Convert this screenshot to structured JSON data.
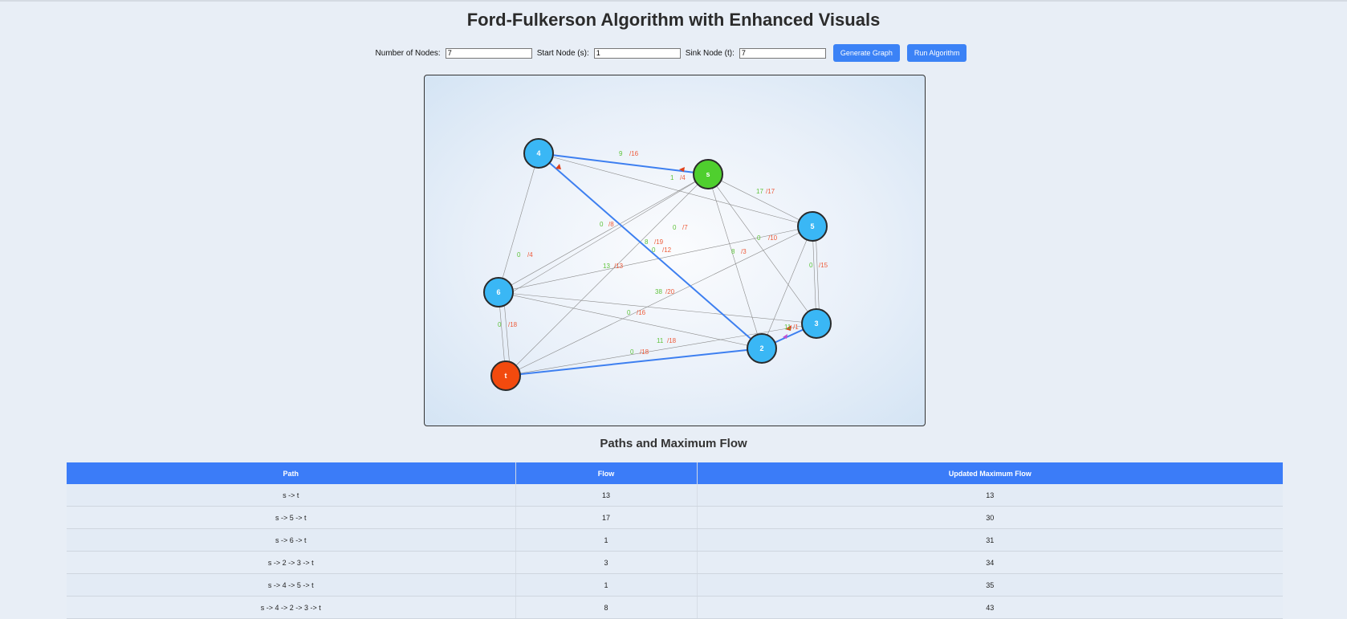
{
  "title": "Ford-Fulkerson Algorithm with Enhanced Visuals",
  "controls": {
    "num_nodes_label": "Number of Nodes:",
    "num_nodes_value": "7",
    "start_node_label": "Start Node (s):",
    "start_node_value": "1",
    "sink_node_label": "Sink Node (t):",
    "sink_node_value": "7",
    "generate_button": "Generate Graph",
    "run_button": "Run Algorithm"
  },
  "graph": {
    "nodes": [
      "4",
      "s",
      "5",
      "6",
      "3",
      "2",
      "t"
    ],
    "colors": {
      "node": "#3ab7f5",
      "source": "#4fcf2e",
      "sink": "#f24a0e",
      "highlight": "#3d7ff0",
      "flow": "#5ec33b",
      "capacity": "#ee5b3a"
    },
    "edge_labels": [
      {
        "flow": "9",
        "cap": "/16"
      },
      {
        "flow": "1",
        "cap": "/4"
      },
      {
        "flow": "17",
        "cap": "/17"
      },
      {
        "flow": "0",
        "cap": "/8"
      },
      {
        "flow": "0",
        "cap": "/7"
      },
      {
        "flow": "0",
        "cap": "/4"
      },
      {
        "flow": "8",
        "cap": "/19"
      },
      {
        "flow": "0",
        "cap": "/12"
      },
      {
        "flow": "0",
        "cap": "/10"
      },
      {
        "flow": "8",
        "cap": "/3"
      },
      {
        "flow": "0",
        "cap": "/15"
      },
      {
        "flow": "13",
        "cap": "/13"
      },
      {
        "flow": "38",
        "cap": "/20"
      },
      {
        "flow": "0",
        "cap": "/16"
      },
      {
        "flow": "0",
        "cap": "/18"
      },
      {
        "flow": "11",
        "cap": "/18"
      },
      {
        "flow": "0",
        "cap": "/18"
      },
      {
        "flow": "11",
        "cap": "/1"
      }
    ]
  },
  "table": {
    "heading": "Paths and Maximum Flow",
    "columns": [
      "Path",
      "Flow",
      "Updated Maximum Flow"
    ],
    "rows": [
      {
        "path": "s -> t",
        "flow": "13",
        "max": "13"
      },
      {
        "path": "s -> 5 -> t",
        "flow": "17",
        "max": "30"
      },
      {
        "path": "s -> 6 -> t",
        "flow": "1",
        "max": "31"
      },
      {
        "path": "s -> 2 -> 3 -> t",
        "flow": "3",
        "max": "34"
      },
      {
        "path": "s -> 4 -> 5 -> t",
        "flow": "1",
        "max": "35"
      },
      {
        "path": "s -> 4 -> 2 -> 3 -> t",
        "flow": "8",
        "max": "43"
      }
    ]
  }
}
